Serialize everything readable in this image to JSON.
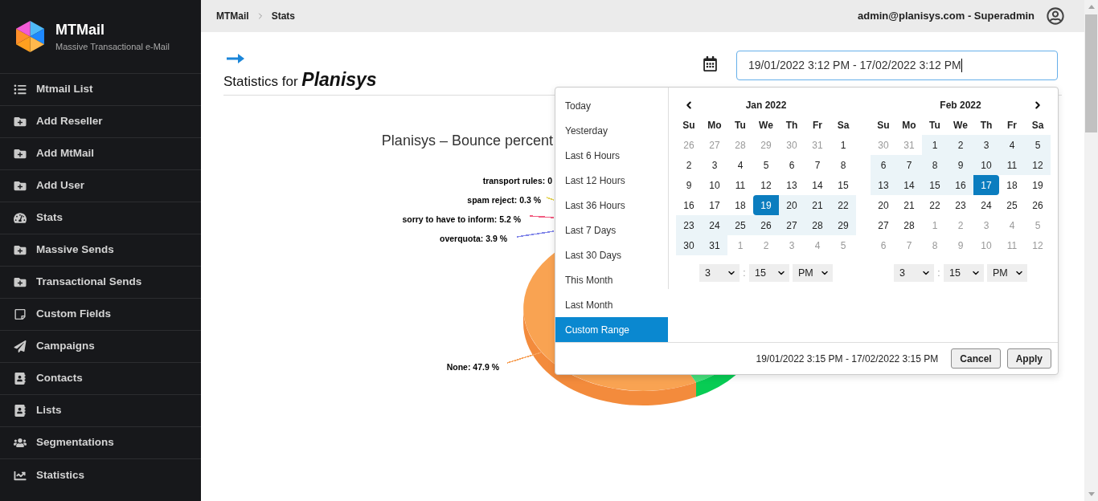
{
  "sidebar": {
    "brand": {
      "name": "MTMail",
      "tagline": "Massive Transactional e-Mail"
    },
    "items": [
      {
        "label": "Mtmail List"
      },
      {
        "label": "Add Reseller"
      },
      {
        "label": "Add MtMail"
      },
      {
        "label": "Add User"
      },
      {
        "label": "Stats"
      },
      {
        "label": "Massive Sends"
      },
      {
        "label": "Transactional Sends"
      },
      {
        "label": "Custom Fields"
      },
      {
        "label": "Campaigns"
      },
      {
        "label": "Contacts"
      },
      {
        "label": "Lists"
      },
      {
        "label": "Segmentations"
      },
      {
        "label": "Statistics"
      }
    ]
  },
  "header": {
    "breadcrumb": [
      "MTMail",
      "Stats"
    ],
    "user": "admin@planisys.com - Superadmin"
  },
  "page": {
    "heading": {
      "prefix": "Statistics for",
      "name": "Planisys"
    },
    "date_field": {
      "value": "19/01/2022 3:12 PM - 17/02/2022 3:12 PM",
      "focused": true
    }
  },
  "chart": {
    "title": "Planisys – Bounce percent",
    "labels": [
      {
        "text": "transport rules: 0"
      },
      {
        "text": "spam reject: 0.3 %",
        "color": "#e4d354"
      },
      {
        "text": "sorry to have to inform: 5.2 %",
        "color": "#f15c80"
      },
      {
        "text": "overquota: 3.9 %",
        "color": "#8085e9"
      },
      {
        "text": "None: 47.9 %",
        "color": "#f7a35c"
      }
    ]
  },
  "datepicker": {
    "ranges": [
      {
        "label": "Today",
        "selected": false
      },
      {
        "label": "Yesterday",
        "selected": false
      },
      {
        "label": "Last 6 Hours",
        "selected": false
      },
      {
        "label": "Last 12 Hours",
        "selected": false
      },
      {
        "label": "Last 36 Hours",
        "selected": false
      },
      {
        "label": "Last 7 Days",
        "selected": false
      },
      {
        "label": "Last 30 Days",
        "selected": false
      },
      {
        "label": "This Month",
        "selected": false
      },
      {
        "label": "Last Month",
        "selected": false
      },
      {
        "label": "Custom Range",
        "selected": true
      }
    ],
    "calendars": [
      {
        "month": "Jan 2022",
        "has_prev": true,
        "has_next": false,
        "weekdays": [
          "Su",
          "Mo",
          "Tu",
          "We",
          "Th",
          "Fr",
          "Sa"
        ],
        "weeks": [
          [
            {
              "day": "26",
              "off": true,
              "in_range": false,
              "selected": false
            },
            {
              "day": "27",
              "off": true,
              "in_range": false,
              "selected": false
            },
            {
              "day": "28",
              "off": true,
              "in_range": false,
              "selected": false
            },
            {
              "day": "29",
              "off": true,
              "in_range": false,
              "selected": false
            },
            {
              "day": "30",
              "off": true,
              "in_range": false,
              "selected": false
            },
            {
              "day": "31",
              "off": true,
              "in_range": false,
              "selected": false
            },
            {
              "day": "1",
              "off": false,
              "in_range": false,
              "selected": false
            }
          ],
          [
            {
              "day": "2",
              "off": false,
              "in_range": false,
              "selected": false
            },
            {
              "day": "3",
              "off": false,
              "in_range": false,
              "selected": false
            },
            {
              "day": "4",
              "off": false,
              "in_range": false,
              "selected": false
            },
            {
              "day": "5",
              "off": false,
              "in_range": false,
              "selected": false
            },
            {
              "day": "6",
              "off": false,
              "in_range": false,
              "selected": false
            },
            {
              "day": "7",
              "off": false,
              "in_range": false,
              "selected": false
            },
            {
              "day": "8",
              "off": false,
              "in_range": false,
              "selected": false
            }
          ],
          [
            {
              "day": "9",
              "off": false,
              "in_range": false,
              "selected": false
            },
            {
              "day": "10",
              "off": false,
              "in_range": false,
              "selected": false
            },
            {
              "day": "11",
              "off": false,
              "in_range": false,
              "selected": false
            },
            {
              "day": "12",
              "off": false,
              "in_range": false,
              "selected": false
            },
            {
              "day": "13",
              "off": false,
              "in_range": false,
              "selected": false
            },
            {
              "day": "14",
              "off": false,
              "in_range": false,
              "selected": false
            },
            {
              "day": "15",
              "off": false,
              "in_range": false,
              "selected": false
            }
          ],
          [
            {
              "day": "16",
              "off": false,
              "in_range": false,
              "selected": false
            },
            {
              "day": "17",
              "off": false,
              "in_range": false,
              "selected": false
            },
            {
              "day": "18",
              "off": false,
              "in_range": false,
              "selected": false
            },
            {
              "day": "19",
              "off": false,
              "in_range": true,
              "selected": true
            },
            {
              "day": "20",
              "off": false,
              "in_range": true,
              "selected": false
            },
            {
              "day": "21",
              "off": false,
              "in_range": true,
              "selected": false
            },
            {
              "day": "22",
              "off": false,
              "in_range": true,
              "selected": false
            }
          ],
          [
            {
              "day": "23",
              "off": false,
              "in_range": true,
              "selected": false
            },
            {
              "day": "24",
              "off": false,
              "in_range": true,
              "selected": false
            },
            {
              "day": "25",
              "off": false,
              "in_range": true,
              "selected": false
            },
            {
              "day": "26",
              "off": false,
              "in_range": true,
              "selected": false
            },
            {
              "day": "27",
              "off": false,
              "in_range": true,
              "selected": false
            },
            {
              "day": "28",
              "off": false,
              "in_range": true,
              "selected": false
            },
            {
              "day": "29",
              "off": false,
              "in_range": true,
              "selected": false
            }
          ],
          [
            {
              "day": "30",
              "off": false,
              "in_range": true,
              "selected": false
            },
            {
              "day": "31",
              "off": false,
              "in_range": true,
              "selected": false
            },
            {
              "day": "1",
              "off": true,
              "in_range": false,
              "selected": false
            },
            {
              "day": "2",
              "off": true,
              "in_range": false,
              "selected": false
            },
            {
              "day": "3",
              "off": true,
              "in_range": false,
              "selected": false
            },
            {
              "day": "4",
              "off": true,
              "in_range": false,
              "selected": false
            },
            {
              "day": "5",
              "off": true,
              "in_range": false,
              "selected": false
            }
          ]
        ],
        "time": {
          "hour": "3",
          "separator": ":",
          "minute": "15",
          "period": "PM"
        }
      },
      {
        "month": "Feb 2022",
        "has_prev": false,
        "has_next": true,
        "weekdays": [
          "Su",
          "Mo",
          "Tu",
          "We",
          "Th",
          "Fr",
          "Sa"
        ],
        "weeks": [
          [
            {
              "day": "30",
              "off": true,
              "in_range": false,
              "selected": false
            },
            {
              "day": "31",
              "off": true,
              "in_range": false,
              "selected": false
            },
            {
              "day": "1",
              "off": false,
              "in_range": true,
              "selected": false
            },
            {
              "day": "2",
              "off": false,
              "in_range": true,
              "selected": false
            },
            {
              "day": "3",
              "off": false,
              "in_range": true,
              "selected": false
            },
            {
              "day": "4",
              "off": false,
              "in_range": true,
              "selected": false
            },
            {
              "day": "5",
              "off": false,
              "in_range": true,
              "selected": false
            }
          ],
          [
            {
              "day": "6",
              "off": false,
              "in_range": true,
              "selected": false
            },
            {
              "day": "7",
              "off": false,
              "in_range": true,
              "selected": false
            },
            {
              "day": "8",
              "off": false,
              "in_range": true,
              "selected": false
            },
            {
              "day": "9",
              "off": false,
              "in_range": true,
              "selected": false
            },
            {
              "day": "10",
              "off": false,
              "in_range": true,
              "selected": false
            },
            {
              "day": "11",
              "off": false,
              "in_range": true,
              "selected": false
            },
            {
              "day": "12",
              "off": false,
              "in_range": true,
              "selected": false
            }
          ],
          [
            {
              "day": "13",
              "off": false,
              "in_range": true,
              "selected": false
            },
            {
              "day": "14",
              "off": false,
              "in_range": true,
              "selected": false
            },
            {
              "day": "15",
              "off": false,
              "in_range": true,
              "selected": false
            },
            {
              "day": "16",
              "off": false,
              "in_range": true,
              "selected": false
            },
            {
              "day": "17",
              "off": false,
              "in_range": true,
              "selected": true
            },
            {
              "day": "18",
              "off": false,
              "in_range": false,
              "selected": false
            },
            {
              "day": "19",
              "off": false,
              "in_range": false,
              "selected": false
            }
          ],
          [
            {
              "day": "20",
              "off": false,
              "in_range": false,
              "selected": false
            },
            {
              "day": "21",
              "off": false,
              "in_range": false,
              "selected": false
            },
            {
              "day": "22",
              "off": false,
              "in_range": false,
              "selected": false
            },
            {
              "day": "23",
              "off": false,
              "in_range": false,
              "selected": false
            },
            {
              "day": "24",
              "off": false,
              "in_range": false,
              "selected": false
            },
            {
              "day": "25",
              "off": false,
              "in_range": false,
              "selected": false
            },
            {
              "day": "26",
              "off": false,
              "in_range": false,
              "selected": false
            }
          ],
          [
            {
              "day": "27",
              "off": false,
              "in_range": false,
              "selected": false
            },
            {
              "day": "28",
              "off": false,
              "in_range": false,
              "selected": false
            },
            {
              "day": "1",
              "off": true,
              "in_range": false,
              "selected": false
            },
            {
              "day": "2",
              "off": true,
              "in_range": false,
              "selected": false
            },
            {
              "day": "3",
              "off": true,
              "in_range": false,
              "selected": false
            },
            {
              "day": "4",
              "off": true,
              "in_range": false,
              "selected": false
            },
            {
              "day": "5",
              "off": true,
              "in_range": false,
              "selected": false
            }
          ],
          [
            {
              "day": "6",
              "off": true,
              "in_range": false,
              "selected": false
            },
            {
              "day": "7",
              "off": true,
              "in_range": false,
              "selected": false
            },
            {
              "day": "8",
              "off": true,
              "in_range": false,
              "selected": false
            },
            {
              "day": "9",
              "off": true,
              "in_range": false,
              "selected": false
            },
            {
              "day": "10",
              "off": true,
              "in_range": false,
              "selected": false
            },
            {
              "day": "11",
              "off": true,
              "in_range": false,
              "selected": false
            },
            {
              "day": "12",
              "off": true,
              "in_range": false,
              "selected": false
            }
          ]
        ],
        "time": {
          "hour": "3",
          "separator": ":",
          "minute": "15",
          "period": "PM"
        }
      }
    ],
    "selected_range": "19/01/2022 3:15 PM - 17/02/2022 3:15 PM",
    "buttons": [
      "Cancel",
      "Apply"
    ]
  }
}
